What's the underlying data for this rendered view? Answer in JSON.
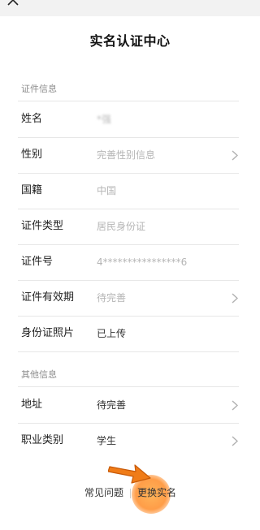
{
  "header": {
    "title": "实名认证中心"
  },
  "sections": [
    {
      "label": "证件信息",
      "rows": [
        {
          "label": "姓名",
          "value": "*强",
          "style": "blur",
          "chevron": false
        },
        {
          "label": "性别",
          "value": "完善性别信息",
          "style": "muted",
          "chevron": true
        },
        {
          "label": "国籍",
          "value": "中国",
          "style": "muted",
          "chevron": false
        },
        {
          "label": "证件类型",
          "value": "居民身份证",
          "style": "muted",
          "chevron": false
        },
        {
          "label": "证件号",
          "value": "4****************6",
          "style": "muted",
          "chevron": false
        },
        {
          "label": "证件有效期",
          "value": "待完善",
          "style": "muted",
          "chevron": true
        },
        {
          "label": "身份证照片",
          "value": "已上传",
          "style": "normal",
          "chevron": false
        }
      ]
    },
    {
      "label": "其他信息",
      "rows": [
        {
          "label": "地址",
          "value": "待完善",
          "style": "normal",
          "chevron": true
        },
        {
          "label": "职业类别",
          "value": "学生",
          "style": "normal",
          "chevron": true
        }
      ]
    }
  ],
  "footer": {
    "faq_label": "常见问题",
    "change_label": "更换实名"
  },
  "colors": {
    "highlight": "#ff8c28",
    "arrow": "#f07c18"
  }
}
